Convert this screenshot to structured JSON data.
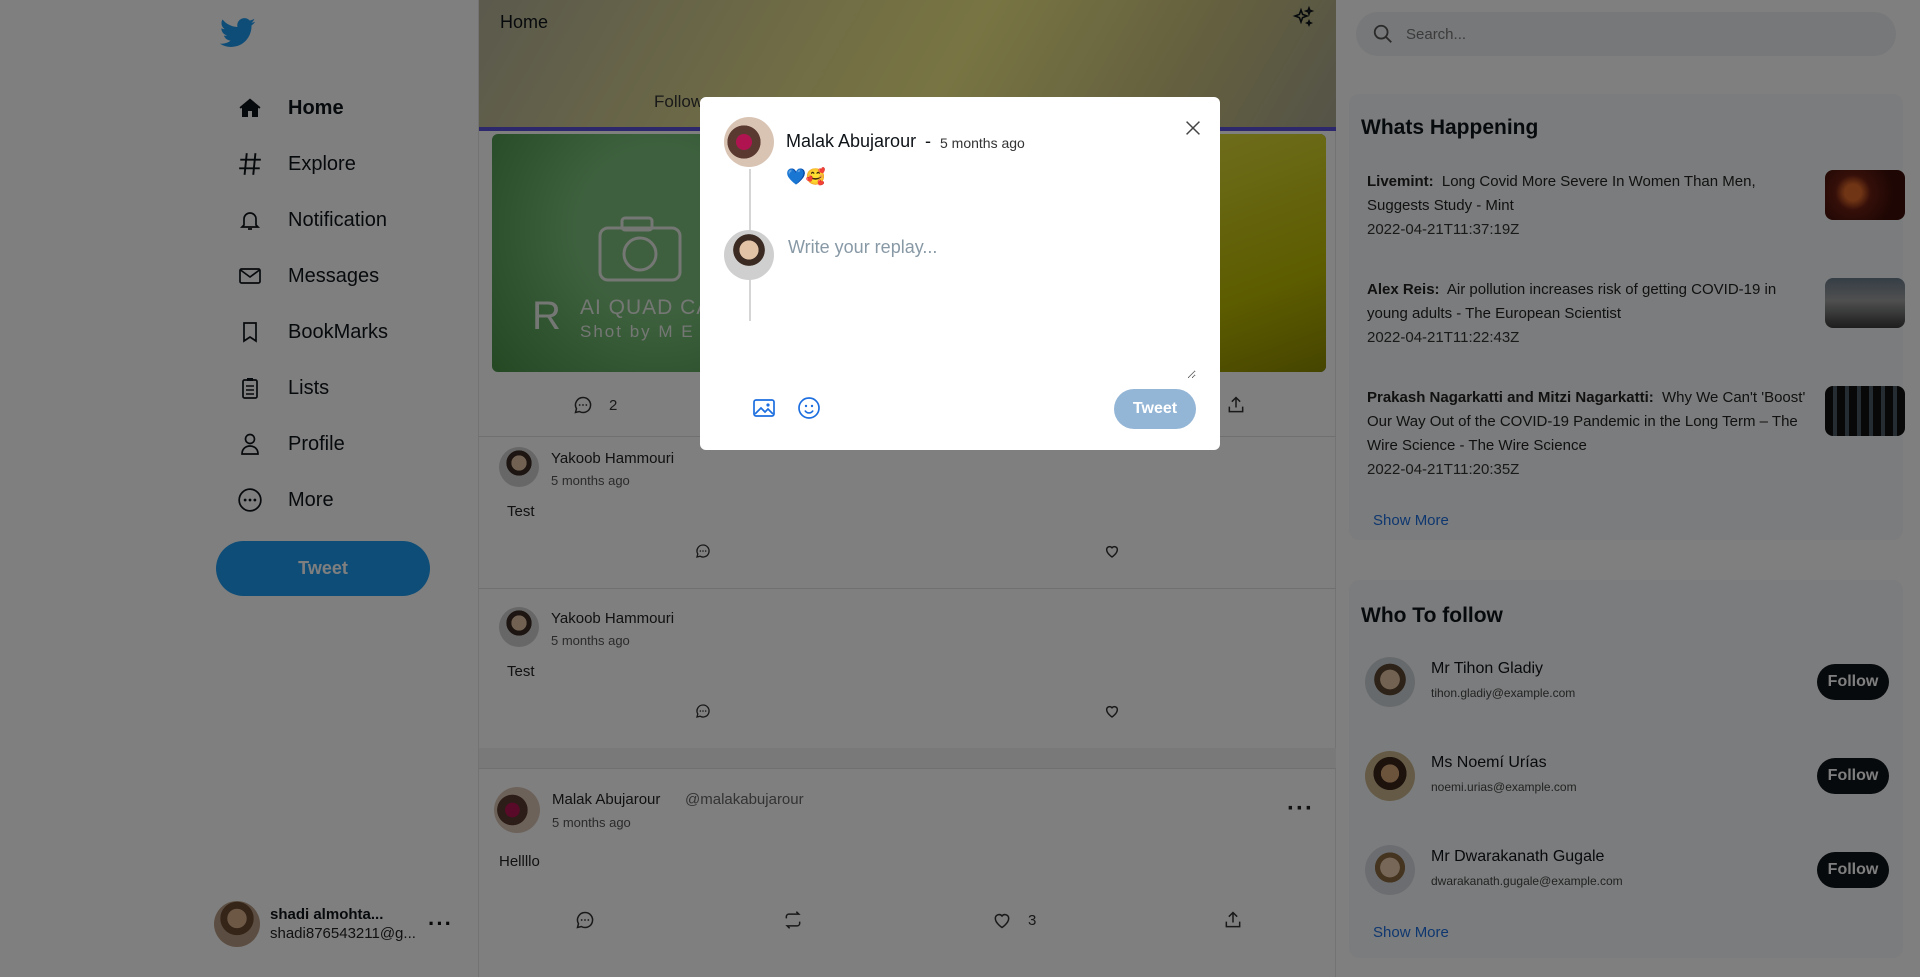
{
  "sidebar": {
    "nav": [
      {
        "label": "Home",
        "icon": "home-icon"
      },
      {
        "label": "Explore",
        "icon": "hashtag-icon"
      },
      {
        "label": "Notification",
        "icon": "bell-icon"
      },
      {
        "label": "Messages",
        "icon": "mail-icon"
      },
      {
        "label": "BookMarks",
        "icon": "bookmark-icon"
      },
      {
        "label": "Lists",
        "icon": "list-icon"
      },
      {
        "label": "Profile",
        "icon": "user-icon"
      },
      {
        "label": "More",
        "icon": "more-circle-icon"
      }
    ],
    "tweet_label": "Tweet",
    "account": {
      "name": "shadi almohta...",
      "email": "shadi876543211@g...",
      "more": "···"
    }
  },
  "feed": {
    "header_title": "Home",
    "tab_following": "Follow",
    "media": {
      "brand": "R",
      "line1": "AI QUAD CA",
      "line2": "Shot by M E M"
    },
    "first_post_comments": "2",
    "posts": [
      {
        "author": "Yakoob Hammouri",
        "time": "5 months ago",
        "body": "Test"
      },
      {
        "author": "Yakoob Hammouri",
        "time": "5 months ago",
        "body": "Test"
      },
      {
        "author": "Malak Abujarour",
        "handle": "@malakabujarour",
        "time": "5 months ago",
        "body": "Hellllo",
        "likes": "3",
        "more": "···"
      }
    ]
  },
  "right": {
    "search_placeholder": "Search...",
    "whats_happening": {
      "title": "Whats Happening",
      "items": [
        {
          "source": "Livemint:",
          "text": "Long Covid More Severe In Women Than Men, Suggests Study - Mint",
          "time": "2022-04-21T11:37:19Z"
        },
        {
          "source": "Alex Reis:",
          "text": "Air pollution increases risk of getting COVID-19 in young adults - The European Scientist",
          "time": "2022-04-21T11:22:43Z"
        },
        {
          "source": "Prakash Nagarkatti and Mitzi Nagarkatti:",
          "text": "Why We Can't 'Boost' Our Way Out of the COVID-19 Pandemic in the Long Term – The Wire Science - The Wire Science",
          "time": "2022-04-21T11:20:35Z"
        }
      ],
      "show_more": "Show More"
    },
    "who_to_follow": {
      "title": "Who To follow",
      "items": [
        {
          "name": "Mr Tihon Gladiy",
          "email": "tihon.gladiy@example.com",
          "button": "Follow"
        },
        {
          "name": "Ms Noemí Urías",
          "email": "noemi.urias@example.com",
          "button": "Follow"
        },
        {
          "name": "Mr Dwarakanath Gugale",
          "email": "dwarakanath.gugale@example.com",
          "button": "Follow"
        }
      ],
      "show_more": "Show More"
    }
  },
  "modal": {
    "author": "Malak Abujarour",
    "separator": "-",
    "time": "5 months ago",
    "content": "💙🥰",
    "reply_placeholder": "Write your replay...",
    "tweet_label": "Tweet"
  },
  "colors": {
    "accent": "#1d9bf0",
    "tab_underline": "#5b4fd8",
    "link": "#1d6fe0",
    "disabled_tweet": "#93b5d6"
  }
}
